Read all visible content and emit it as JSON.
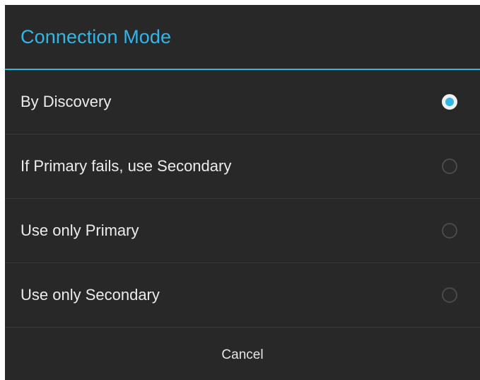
{
  "dialog": {
    "title": "Connection Mode",
    "options": [
      {
        "label": "By Discovery",
        "selected": true
      },
      {
        "label": "If Primary fails, use Secondary",
        "selected": false
      },
      {
        "label": "Use only Primary",
        "selected": false
      },
      {
        "label": "Use only Secondary",
        "selected": false
      }
    ],
    "cancel_label": "Cancel"
  },
  "colors": {
    "accent": "#33b5e5",
    "background": "#282828",
    "divider": "#3a3a3a",
    "text": "#ececec"
  }
}
